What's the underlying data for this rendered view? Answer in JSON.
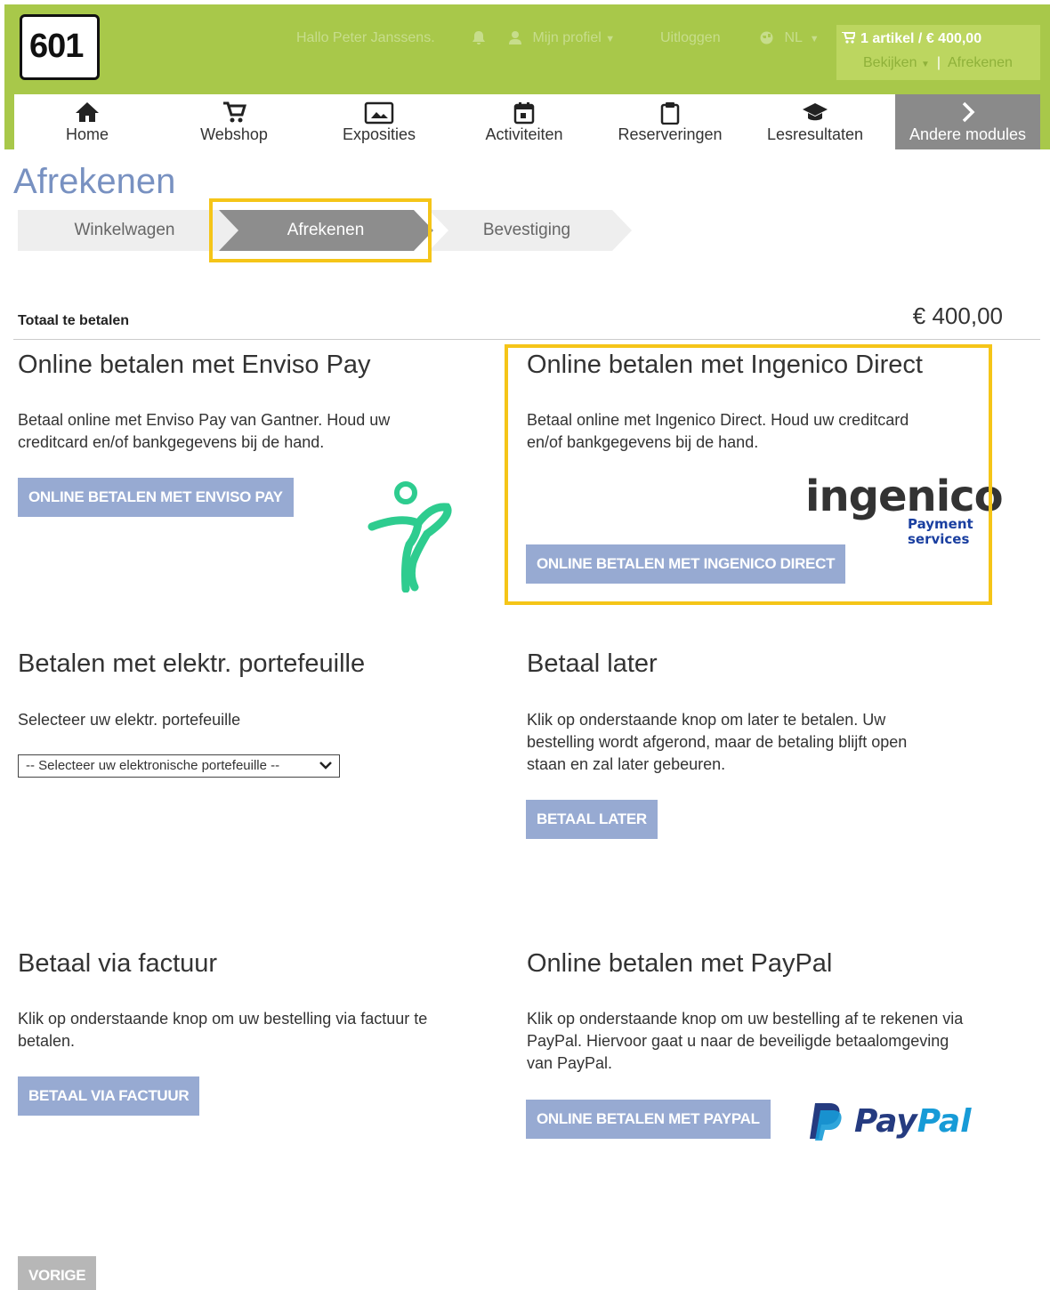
{
  "logo": {
    "text": "601"
  },
  "topnav": {
    "greeting": "Hallo Peter Janssens.",
    "profile": "Mijn profiel",
    "logout": "Uitloggen",
    "language": "NL"
  },
  "cart": {
    "summary": "1 artikel / € 400,00",
    "view": "Bekijken",
    "checkout": "Afrekenen"
  },
  "mainnav": {
    "items": [
      {
        "label": "Home",
        "icon": "home-icon"
      },
      {
        "label": "Webshop",
        "icon": "cart-icon"
      },
      {
        "label": "Exposities",
        "icon": "image-icon"
      },
      {
        "label": "Activiteiten",
        "icon": "calendar-icon"
      },
      {
        "label": "Reserveringen",
        "icon": "clipboard-icon"
      },
      {
        "label": "Lesresultaten",
        "icon": "graduation-cap-icon"
      }
    ],
    "more": "Andere modules"
  },
  "page_title": "Afrekenen",
  "steps": [
    "Winkelwagen",
    "Afrekenen",
    "Bevestiging"
  ],
  "total": {
    "label": "Totaal te betalen",
    "value": "€ 400,00"
  },
  "sections": {
    "enviso": {
      "title": "Online betalen met Enviso Pay",
      "text": "Betaal online met Enviso Pay van Gantner. Houd uw creditcard en/of bankgegevens bij de hand.",
      "button": "ONLINE BETALEN MET ENVISO PAY"
    },
    "ingenico": {
      "title": "Online betalen met Ingenico Direct",
      "text": "Betaal online met Ingenico Direct. Houd uw creditcard en/of bankgegevens bij de hand.",
      "logo_word": "ingenico",
      "logo_sub1": "Payment",
      "logo_sub2": "services",
      "button": "ONLINE BETALEN MET INGENICO DIRECT"
    },
    "wallet": {
      "title": "Betalen met elektr. portefeuille",
      "text": "Selecteer uw elektr. portefeuille",
      "select": "-- Selecteer uw elektronische portefeuille --"
    },
    "later": {
      "title": "Betaal later",
      "text": "Klik op onderstaande knop om later te betalen. Uw bestelling wordt afgerond, maar de betaling blijft open staan en zal later gebeuren.",
      "button": "BETAAL LATER"
    },
    "invoice": {
      "title": "Betaal via factuur",
      "text": "Klik op onderstaande knop om uw bestelling via factuur te betalen.",
      "button": "BETAAL VIA FACTUUR"
    },
    "paypal": {
      "title": "Online betalen met PayPal",
      "text": "Klik op onderstaande knop om uw bestelling af te rekenen via PayPal. Hiervoor gaat u naar de beveiligde betaalomgeving van PayPal.",
      "logo_pay": "Pay",
      "logo_pal": "Pal",
      "button": "ONLINE BETALEN MET PAYPAL"
    }
  },
  "back_button": "VORIGE",
  "colors": {
    "header_green": "#a8c84a",
    "button_blue": "#97aad2",
    "title_blue": "#7891c1",
    "highlight_yellow": "#f5c518",
    "enviso_green": "#2ecc8f"
  }
}
